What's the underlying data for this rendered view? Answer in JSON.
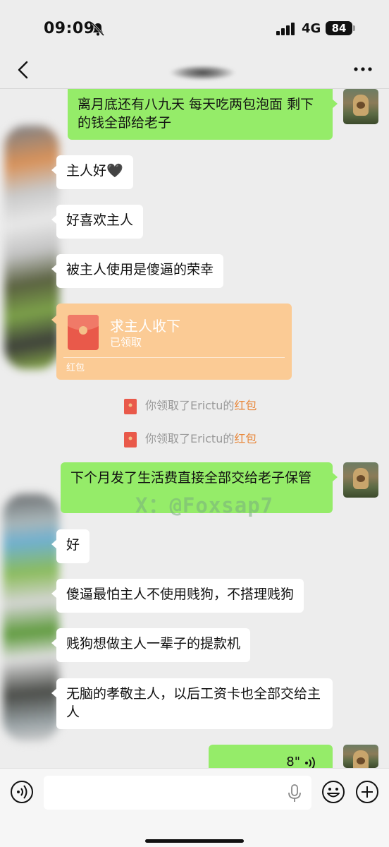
{
  "status_bar": {
    "time": "09:09",
    "network": "4G",
    "battery": "84"
  },
  "messages": [
    {
      "side": "me",
      "text": "离月底还有八九天 每天吃两包泡面 剩下的钱全部给老子"
    },
    {
      "side": "them",
      "text": "主人好🖤"
    },
    {
      "side": "them",
      "text": "好喜欢主人"
    },
    {
      "side": "them",
      "text": "被主人使用是傻逼的荣幸"
    },
    {
      "side": "them",
      "type": "red_packet",
      "title": "求主人收下",
      "status": "已领取",
      "label": "红包"
    },
    {
      "side": "system",
      "prefix": "你领取了Erictu的",
      "link": "红包"
    },
    {
      "side": "system",
      "prefix": "你领取了Erictu的",
      "link": "红包"
    },
    {
      "side": "me",
      "text": "下个月发了生活费直接全部交给老子保管"
    },
    {
      "side": "them",
      "text": "好"
    },
    {
      "side": "them",
      "text": "傻逼最怕主人不使用贱狗，不搭理贱狗"
    },
    {
      "side": "them",
      "text": "贱狗想做主人一辈子的提款机"
    },
    {
      "side": "them",
      "text": "无脑的孝敬主人，以后工资卡也全部交给主人"
    },
    {
      "side": "me",
      "type": "voice",
      "duration": "8\""
    }
  ],
  "watermark": "X：@Foxsap7",
  "input": {
    "placeholder": ""
  },
  "colors": {
    "my_bubble": "#95ec69",
    "their_bubble": "#ffffff",
    "red_packet": "#fbcb95",
    "link": "#e8873a",
    "background": "#ededed"
  }
}
